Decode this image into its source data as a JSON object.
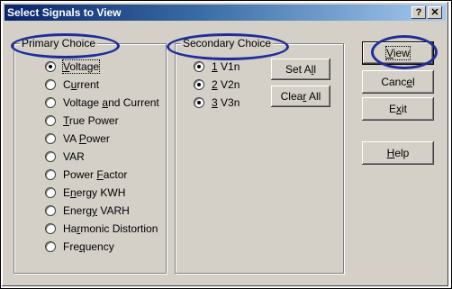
{
  "window": {
    "title": "Select Signals to View"
  },
  "title_buttons": {
    "help": "?",
    "close": "✕"
  },
  "primary": {
    "legend": "Primary Choice",
    "items": [
      {
        "pre": "",
        "u": "V",
        "post": "oltage",
        "checked": true
      },
      {
        "pre": "C",
        "u": "u",
        "post": "rrent",
        "checked": false
      },
      {
        "pre": "Voltage ",
        "u": "a",
        "post": "nd Current",
        "checked": false
      },
      {
        "pre": "",
        "u": "T",
        "post": "rue Power",
        "checked": false
      },
      {
        "pre": "VA ",
        "u": "P",
        "post": "ower",
        "checked": false
      },
      {
        "pre": "VAR",
        "u": "",
        "post": "",
        "checked": false
      },
      {
        "pre": "Power ",
        "u": "F",
        "post": "actor",
        "checked": false
      },
      {
        "pre": "E",
        "u": "n",
        "post": "ergy KWH",
        "checked": false
      },
      {
        "pre": "Energ",
        "u": "y",
        "post": " VARH",
        "checked": false
      },
      {
        "pre": "Ha",
        "u": "r",
        "post": "monic Distortion",
        "checked": false
      },
      {
        "pre": "Fre",
        "u": "q",
        "post": "uency",
        "checked": false
      }
    ]
  },
  "secondary": {
    "legend": "Secondary Choice",
    "items": [
      {
        "pre": "",
        "u": "1",
        "post": " V1n",
        "checked": true
      },
      {
        "pre": "",
        "u": "2",
        "post": " V2n",
        "checked": true
      },
      {
        "pre": "",
        "u": "3",
        "post": " V3n",
        "checked": true
      }
    ],
    "set_all": {
      "pre": "Set A",
      "u": "l",
      "post": "l"
    },
    "clear_all": {
      "pre": "Clea",
      "u": "r",
      "post": " All"
    }
  },
  "buttons": {
    "view": {
      "pre": "",
      "u": "V",
      "post": "iew"
    },
    "cancel": {
      "pre": "Canc",
      "u": "e",
      "post": "l"
    },
    "exit": {
      "pre": "E",
      "u": "x",
      "post": "it"
    },
    "help": {
      "pre": "",
      "u": "H",
      "post": "elp"
    }
  },
  "colors": {
    "highlight_ellipse": "#1f2d9a",
    "title_bar": "#0a246a",
    "face": "#d4d0c8"
  }
}
